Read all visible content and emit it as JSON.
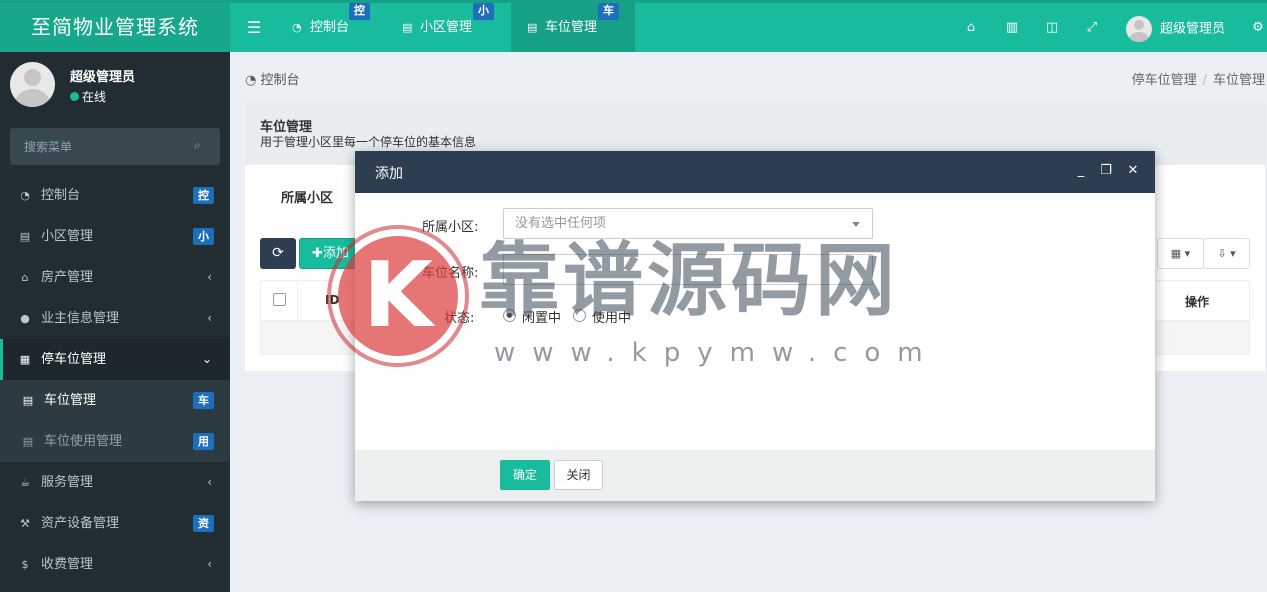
{
  "app": {
    "title": "至简物业管理系统"
  },
  "header": {
    "tabs": [
      {
        "label": "控制台",
        "badge": "控",
        "icon": "dashboard-icon"
      },
      {
        "label": "小区管理",
        "badge": "小",
        "icon": "list-icon"
      },
      {
        "label": "车位管理",
        "badge": "车",
        "icon": "list-icon",
        "active": true
      }
    ],
    "icons": [
      "home-icon",
      "trash-icon",
      "language-icon",
      "fullscreen-icon",
      "settings-icon"
    ],
    "user_name": "超级管理员"
  },
  "sidebar": {
    "user_name": "超级管理员",
    "status": "在线",
    "search_placeholder": "搜索菜单",
    "items": [
      {
        "label": "控制台",
        "badge": "控",
        "icon": "dashboard-icon"
      },
      {
        "label": "小区管理",
        "badge": "小",
        "icon": "list-icon"
      },
      {
        "label": "房产管理",
        "icon": "home-icon",
        "arrow": "‹"
      },
      {
        "label": "业主信息管理",
        "icon": "user-icon",
        "arrow": "‹"
      },
      {
        "label": "停车位管理",
        "icon": "parking-icon",
        "arrow": "⌄",
        "open": true
      },
      {
        "label": "车位管理",
        "badge": "车",
        "icon": "list-icon",
        "sub": true,
        "active": true
      },
      {
        "label": "车位使用管理",
        "badge": "用",
        "icon": "list-icon",
        "sub": true
      },
      {
        "label": "服务管理",
        "icon": "coffee-icon",
        "arrow": "‹"
      },
      {
        "label": "资产设备管理",
        "badge": "资",
        "icon": "gavel-icon"
      },
      {
        "label": "收费管理",
        "icon": "dollar-icon",
        "arrow": "‹"
      }
    ]
  },
  "breadcrumb": {
    "left": "控制台",
    "right": [
      "停车位管理",
      "车位管理"
    ]
  },
  "panel": {
    "title": "车位管理",
    "description": "用于管理小区里每一个停车位的基本信息",
    "filter_tab": "所属小区",
    "add_label": "添加",
    "table": {
      "col_id": "ID",
      "col_op": "操作"
    }
  },
  "modal": {
    "title": "添加",
    "fields": {
      "community_label": "所属小区:",
      "community_placeholder": "没有选中任何项",
      "name_label": "车位名称:",
      "name_value": "",
      "status_label": "状态:",
      "status_options": [
        "闲置中",
        "使用中"
      ],
      "status_selected": "闲置中"
    },
    "ok_label": "确定",
    "close_label": "关闭"
  },
  "watermark": {
    "letter": "K",
    "cn": "靠谱源码网",
    "en": "www.kpymw.com"
  },
  "colors": {
    "primary": "#18bc9c",
    "sidebar": "#222d32",
    "dark": "#2c3e50",
    "badge": "#1e6fbb"
  }
}
